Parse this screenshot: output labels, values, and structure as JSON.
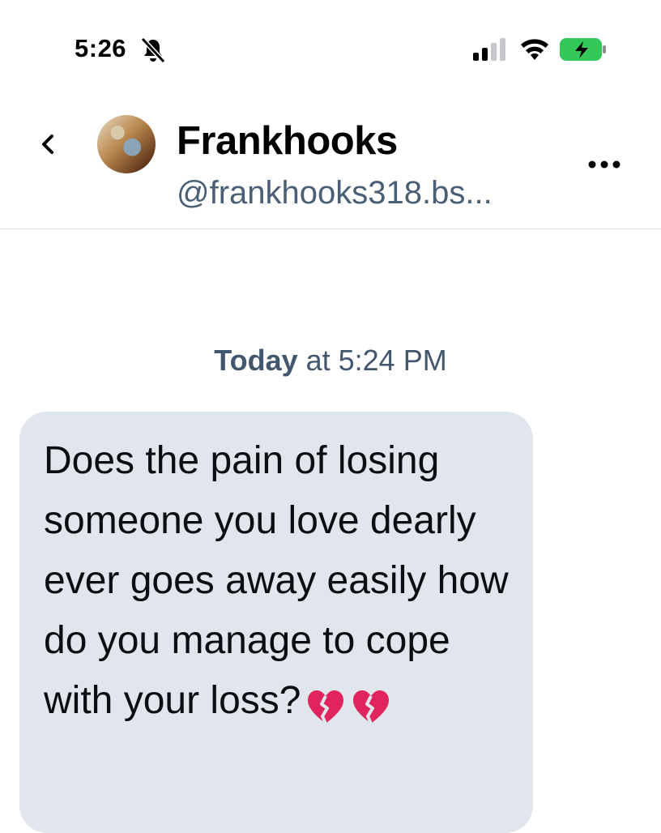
{
  "status_bar": {
    "time": "5:26",
    "icons": [
      "bell-muted-icon",
      "cellular-signal-icon",
      "wifi-icon",
      "battery-charging-icon"
    ],
    "battery_color": "#34c759"
  },
  "header": {
    "display_name": "Frankhooks",
    "handle": "@frankhooks318.bs...",
    "back_icon": "chevron-left-icon",
    "more_icon": "ellipsis-icon"
  },
  "conversation": {
    "timestamp_bold": "Today",
    "timestamp_rest": " at 5:24 PM",
    "messages": [
      {
        "text": "Does the pain of losing someone you love dearly ever goes away easily how do you manage to cope with your loss?",
        "emoji": [
          "broken-heart-icon",
          "broken-heart-icon"
        ],
        "bubble_color": "#e1e6ec"
      }
    ]
  }
}
